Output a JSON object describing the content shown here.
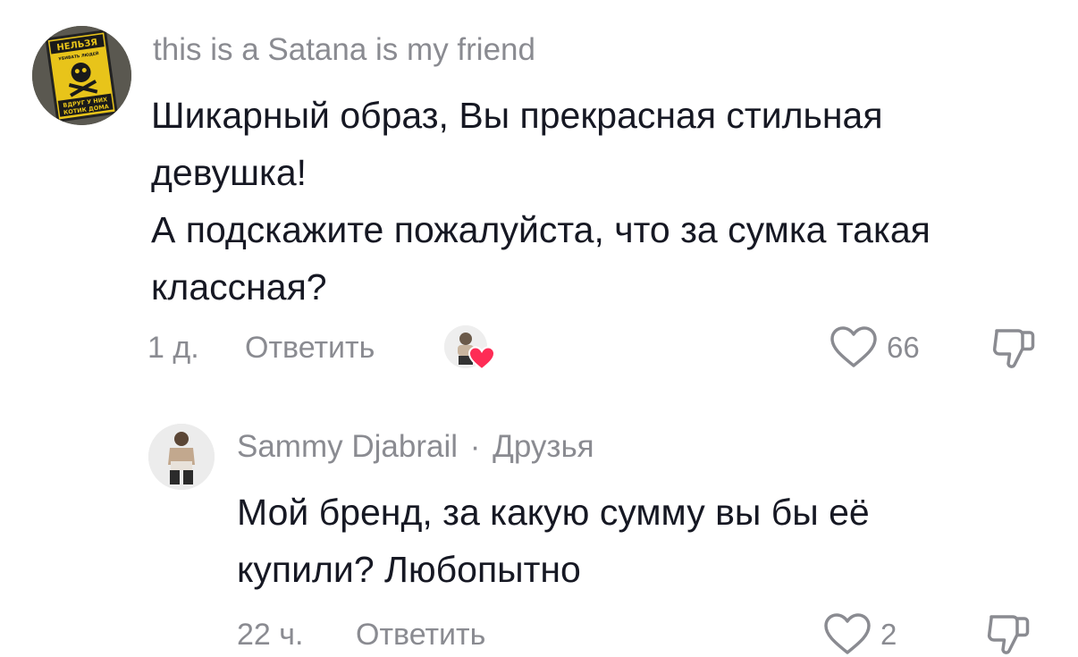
{
  "comments": [
    {
      "username": "this is a Satana is my friend",
      "avatar_text": [
        "НЕЛЬЗЯ",
        "УБИВАТЬ ЛЮДЕЙ",
        "ВДРУГ У НИХ",
        "КОТИК ДОМА"
      ],
      "lines": [
        "Шикарный образ, Вы прекрасная стильная",
        "девушка!",
        "А подскажите пожалуйста, что за сумка такая",
        "классная?"
      ],
      "time": "1 д.",
      "reply_label": "Ответить",
      "likes": "66",
      "liked_by_creator": true
    },
    {
      "username": "Sammy Djabrail",
      "separator": "·",
      "badge": "Друзья",
      "lines": [
        "Мой бренд, за какую сумму вы бы её",
        "купили? Любопытно"
      ],
      "time": "22 ч.",
      "reply_label": "Ответить",
      "likes": "2"
    }
  ],
  "colors": {
    "text": "#161823",
    "muted": "#8a8b91",
    "heart_red": "#fe2c55",
    "icon_gray": "#8a8b91"
  }
}
